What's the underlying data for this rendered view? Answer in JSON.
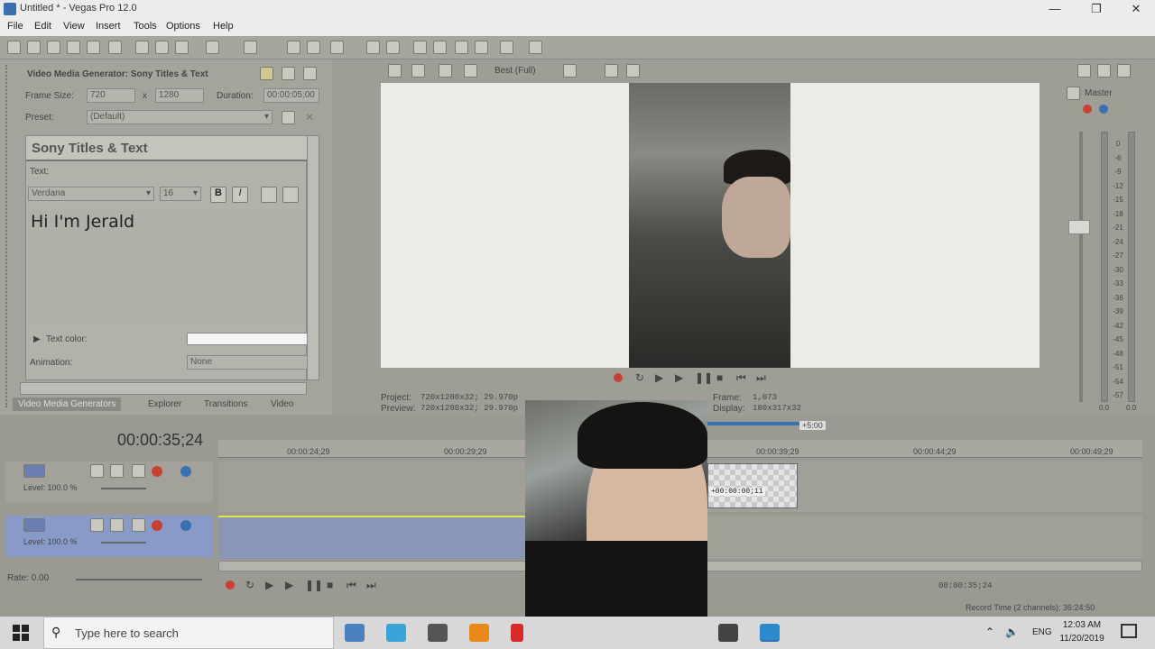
{
  "window": {
    "title": "Untitled * - Vegas Pro 12.0",
    "controls": [
      "—",
      "❐",
      "✕"
    ]
  },
  "menu": [
    "File",
    "Edit",
    "View",
    "Insert",
    "Tools",
    "Options",
    "Help"
  ],
  "media_generator": {
    "header": "Video Media Generator:  Sony Titles & Text",
    "frame_size_label": "Frame Size:",
    "frame_w": "720",
    "frame_x": "x",
    "frame_h": "1280",
    "duration_label": "Duration:",
    "duration": "00:00:05;00",
    "preset_label": "Preset:",
    "preset": "(Default)",
    "plugin_title": "Sony Titles & Text",
    "text_label": "Text:",
    "font": "Verdana",
    "font_size": "16",
    "bold": "B",
    "italic": "I",
    "text_value": "Hi I'm Jerald",
    "text_color_label": "Text color:",
    "animation_label": "Animation:",
    "animation_value": "None"
  },
  "tabs": [
    "Video Media Generators",
    "Explorer",
    "Transitions",
    "Video"
  ],
  "preview": {
    "quality": "Best (Full)",
    "project_label": "Project:",
    "project": "720x1280x32; 29.970p",
    "preview_label": "Preview:",
    "preview": "720x1280x32; 29.970p",
    "frame_label": "Frame:",
    "frame": "1,073",
    "display_label": "Display:",
    "display": "180x317x32"
  },
  "master": {
    "label": "Master",
    "scale": [
      "0",
      "-6",
      "-9",
      "-12",
      "-15",
      "-18",
      "-21",
      "-24",
      "-27",
      "-30",
      "-33",
      "-36",
      "-39",
      "-42",
      "-45",
      "-48",
      "-51",
      "-54",
      "-57"
    ],
    "left_val": "0.0",
    "right_val": "0.0"
  },
  "timeline": {
    "timecode": "00:00:35;24",
    "ruler": [
      "00:00:24;29",
      "00:00:29;29",
      "00:00:39;29",
      "00:00:44;29",
      "00:00:49;29"
    ],
    "marker": "+5:00",
    "clip_label": "+00:00:00;11",
    "track1_level": "Level: 100.0 %",
    "track2_level": "Level: 100.0 %",
    "rate": "Rate: 0.00",
    "cursor_time": "00:00:35;24",
    "record_time": "Record Time (2 channels): 36:24:50"
  },
  "taskbar": {
    "search_placeholder": "Type here to search",
    "time": "12:03 AM",
    "date": "11/20/2019",
    "lang": "ENG"
  }
}
